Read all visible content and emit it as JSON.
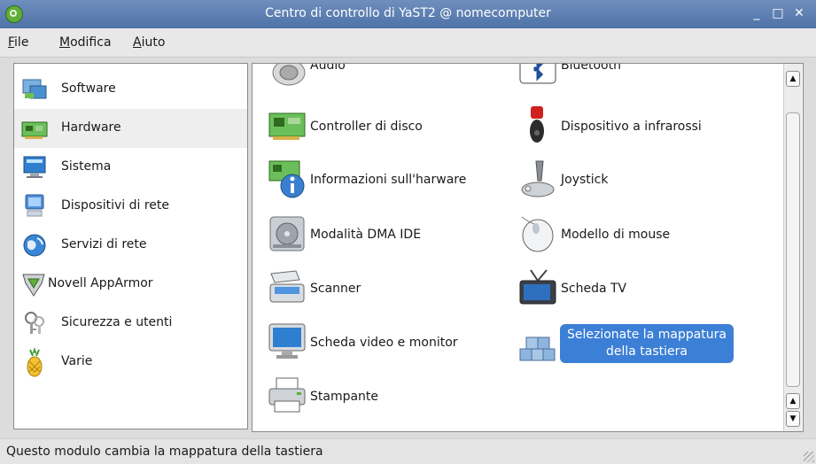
{
  "window": {
    "title": "Centro di controllo di YaST2 @ nomecomputer",
    "minimize_glyph": "_",
    "maximize_glyph": "□",
    "close_glyph": "✕"
  },
  "menu": [
    {
      "label": "File"
    },
    {
      "label": "Modifica"
    },
    {
      "label": "Aiuto"
    }
  ],
  "sidebar": {
    "selected": "Hardware",
    "items": [
      {
        "label": "Software",
        "icon": "software-icon"
      },
      {
        "label": "Hardware",
        "icon": "hardware-card-icon"
      },
      {
        "label": "Sistema",
        "icon": "system-monitor-icon"
      },
      {
        "label": "Dispositivi di rete",
        "icon": "network-computer-icon"
      },
      {
        "label": "Servizi di rete",
        "icon": "globe-icon"
      },
      {
        "label": "Novell AppArmor",
        "icon": "apparmor-shield-icon"
      },
      {
        "label": "Sicurezza e utenti",
        "icon": "keys-icon"
      },
      {
        "label": "Varie",
        "icon": "pineapple-icon"
      }
    ]
  },
  "modules": {
    "left": [
      {
        "label": "Audio",
        "icon": "speaker-icon"
      },
      {
        "label": "Controller di disco",
        "icon": "disk-controller-icon"
      },
      {
        "label": "Informazioni sull'harware",
        "icon": "hardware-info-icon"
      },
      {
        "label": "Modalità DMA IDE",
        "icon": "hard-drive-icon"
      },
      {
        "label": "Scanner",
        "icon": "scanner-icon"
      },
      {
        "label": "Scheda video e monitor",
        "icon": "monitor-icon"
      },
      {
        "label": "Stampante",
        "icon": "printer-icon"
      }
    ],
    "right": [
      {
        "label": "Bluetooth",
        "icon": "bluetooth-icon"
      },
      {
        "label": "Dispositivo a infrarossi",
        "icon": "infrared-icon"
      },
      {
        "label": "Joystick",
        "icon": "joystick-icon"
      },
      {
        "label": "Modello di mouse",
        "icon": "mouse-icon"
      },
      {
        "label": "Scheda TV",
        "icon": "tv-icon"
      },
      {
        "label": "Selezionate la mappatura della tastiera",
        "icon": "keyboard-keys-icon"
      }
    ],
    "selected": "Selezionate la mappatura della tastiera"
  },
  "status": {
    "text": "Questo modulo cambia la mappatura della tastiera"
  },
  "colors": {
    "titlebar": "#4f72a8",
    "selection": "#3c7fd6"
  }
}
